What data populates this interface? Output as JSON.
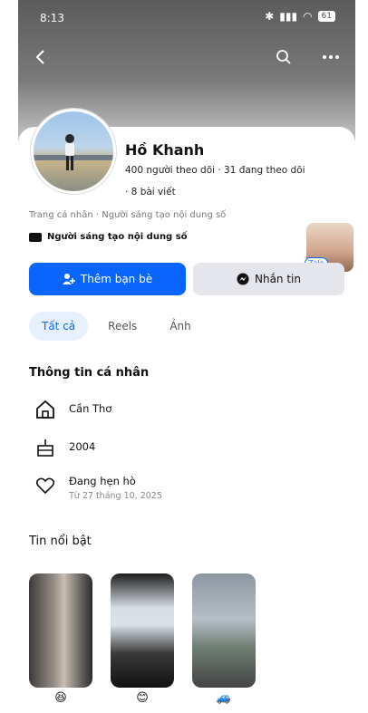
{
  "status": {
    "time": "8:13",
    "battery": "61"
  },
  "profile": {
    "name": "Hồ Khanh",
    "stats_line": "400 người theo dõi · 31 đang theo dõi",
    "posts_line": "· 8 bài viết",
    "bio": "Trang cá nhân · Người sáng tạo nội dung số",
    "creator_label": "Người sáng tạo nội dung số",
    "zalo_badge": "Zalo"
  },
  "actions": {
    "add_friend": "Thêm bạn bè",
    "message": "Nhắn tin"
  },
  "tabs": [
    {
      "label": "Tất cả"
    },
    {
      "label": "Reels"
    },
    {
      "label": "Ảnh"
    }
  ],
  "personal_info": {
    "title": "Thông tin cá nhân",
    "city": "Cần Thơ",
    "birth_year": "2004",
    "relationship": "Đang hẹn hò",
    "relationship_since": "Từ 27 tháng 10, 2025"
  },
  "highlights": {
    "title": "Tin nổi bật",
    "items": [
      {
        "emoji": "😆"
      },
      {
        "emoji": "😊"
      },
      {
        "emoji": "🚙"
      }
    ]
  },
  "colors": {
    "accent": "#0866ff"
  }
}
